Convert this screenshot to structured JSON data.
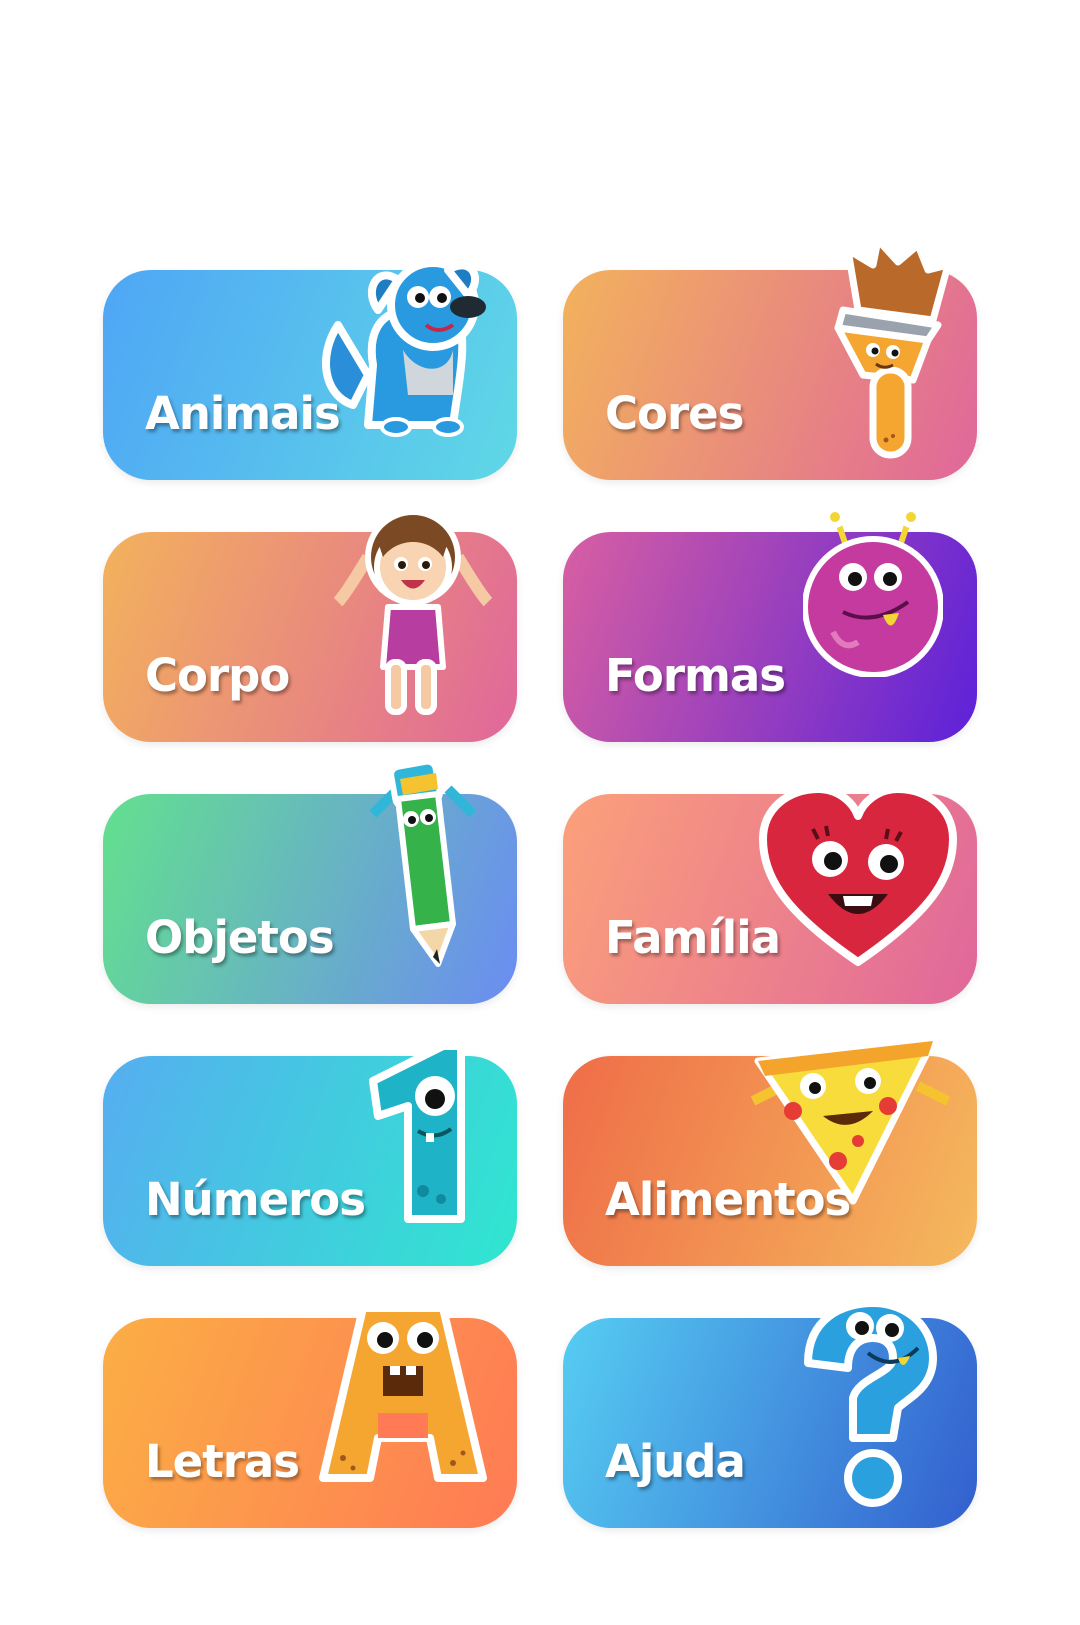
{
  "menu": {
    "cards": [
      {
        "label": "Animais",
        "icon": "dog-icon"
      },
      {
        "label": "Cores",
        "icon": "paintbrush-icon"
      },
      {
        "label": "Corpo",
        "icon": "girl-icon"
      },
      {
        "label": "Formas",
        "icon": "monster-ball-icon"
      },
      {
        "label": "Objetos",
        "icon": "pencil-icon"
      },
      {
        "label": "Família",
        "icon": "heart-icon"
      },
      {
        "label": "Números",
        "icon": "number-one-icon"
      },
      {
        "label": "Alimentos",
        "icon": "pizza-slice-icon"
      },
      {
        "label": "Letras",
        "icon": "letter-a-icon"
      },
      {
        "label": "Ajuda",
        "icon": "question-mark-icon"
      }
    ]
  },
  "colors": {
    "label_text": "#ffffff",
    "page_background": "#ffffff"
  }
}
